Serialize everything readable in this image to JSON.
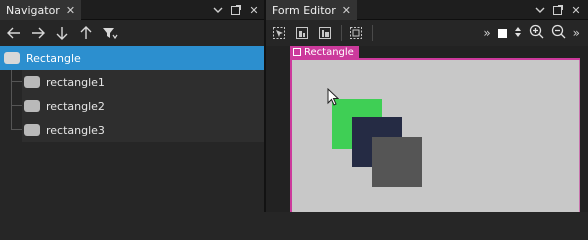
{
  "navigator": {
    "tab_title": "Navigator",
    "tree": [
      {
        "label": "Rectangle",
        "level": 0,
        "selected": true
      },
      {
        "label": "rectangle1",
        "level": 1,
        "selected": false
      },
      {
        "label": "rectangle2",
        "level": 1,
        "selected": false
      },
      {
        "label": "rectangle3",
        "level": 1,
        "selected": false
      }
    ]
  },
  "form_editor": {
    "tab_title": "Form Editor",
    "breadcrumb": "Rectangle"
  },
  "colors": {
    "selection": "#2c8fcf",
    "form_highlight": "#cc3a9c",
    "rect_green": "#3fcf55",
    "rect_navy": "#252b44",
    "rect_gray": "#555555",
    "form_background": "#c8c8c8"
  }
}
